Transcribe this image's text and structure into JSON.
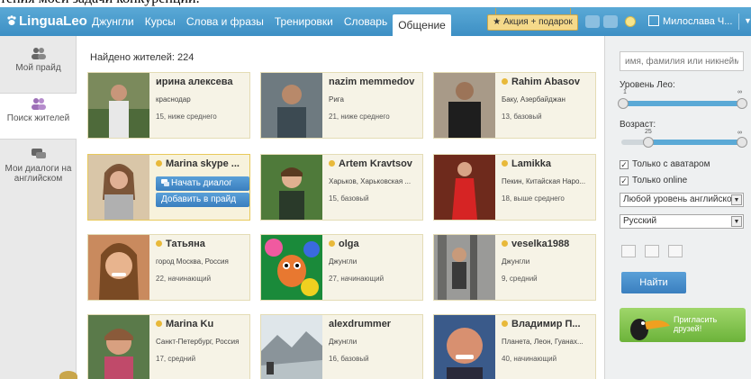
{
  "brand": {
    "name": "LinguaLeo"
  },
  "nav": [
    {
      "label": "Джунгли"
    },
    {
      "label": "Курсы"
    },
    {
      "label": "Слова и фразы"
    },
    {
      "label": "Тренировки"
    },
    {
      "label": "Словарь"
    },
    {
      "label": "Общение",
      "active": true
    }
  ],
  "header": {
    "promo_label": "★ Акция + подарок",
    "user_name": "Милослава Ч...",
    "caret": "▼"
  },
  "sidebar": {
    "items": [
      {
        "label": "Мой прайд",
        "icon": "users-icon"
      },
      {
        "label": "Поиск жителей",
        "icon": "search-users-icon",
        "active": true
      },
      {
        "label": "Мои диалоги на английском",
        "icon": "chat-icon"
      }
    ]
  },
  "main": {
    "found_label": "Найдено жителей: 224",
    "cards": [
      {
        "name": "ирина алексева",
        "online": false,
        "place": "краснодар",
        "level": "15, ниже среднего"
      },
      {
        "name": "nazim memmedov",
        "online": false,
        "place": "Рига",
        "level": "21, ниже среднего"
      },
      {
        "name": "Rahim Abasov",
        "online": true,
        "place": "Баку, Азербайджан",
        "level": "13, базовый"
      },
      {
        "name": "Marina skype ...",
        "online": true,
        "place": "",
        "level": "",
        "selected": true,
        "start_dialog": "Начать диалог",
        "add_pride": "Добавить в прайд"
      },
      {
        "name": "Artem Kravtsov",
        "online": true,
        "place": "Харьков, Харьковская ...",
        "level": "15, базовый"
      },
      {
        "name": "Lamikka",
        "online": true,
        "place": "Пекин, Китайская Наро...",
        "level": "18, выше среднего"
      },
      {
        "name": "Татьяна",
        "online": true,
        "place": "город Москва, Россия",
        "level": "22, начинающий"
      },
      {
        "name": "olga",
        "online": true,
        "place": "Джунгли",
        "level": "27, начинающий"
      },
      {
        "name": "veselka1988",
        "online": true,
        "place": "Джунгли",
        "level": "9, средний"
      },
      {
        "name": "Marina Ku",
        "online": true,
        "place": "Санкт-Петербург, Россия",
        "level": "17, средний"
      },
      {
        "name": "alexdrummer",
        "online": false,
        "place": "Джунгли",
        "level": "16, базовый"
      },
      {
        "name": "Владимир П...",
        "online": true,
        "place": "Планета, Леон, Гуанах...",
        "level": "40, начинающий"
      }
    ]
  },
  "filters": {
    "search_placeholder": "имя, фамилия или никнейм",
    "leo_level_label": "Уровень Лео:",
    "leo_min": "1",
    "leo_max": "∞",
    "age_label": "Возраст:",
    "age_value": "25",
    "age_max": "∞",
    "only_avatar": "Только с аватаром",
    "only_online": "Только online",
    "english_level": "Любой уровень английского",
    "language": "Русский",
    "find_button": "Найти",
    "invite_text": "Пригласить друзей!"
  },
  "colors": {
    "header_blue": "#3d8fc4",
    "card_bg": "#f6f3e6",
    "accent_gold": "#e8b93a",
    "button_blue": "#3a7fbf",
    "invite_green": "#6cb33a"
  }
}
